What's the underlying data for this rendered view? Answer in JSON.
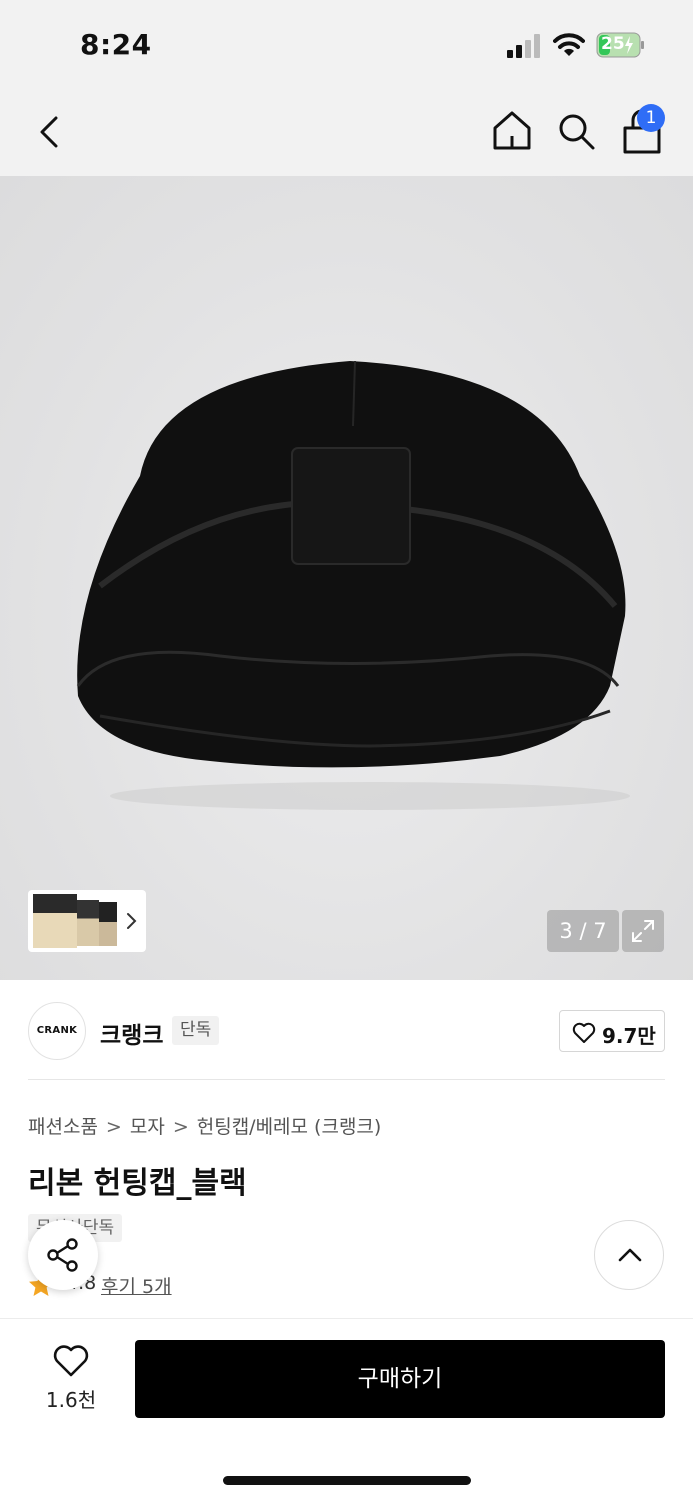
{
  "status_bar": {
    "time": "8:24",
    "battery_level": "25",
    "icons": [
      "signal-icon",
      "wifi-icon",
      "battery-charging-icon"
    ]
  },
  "nav": {
    "icons": [
      "back-arrow-icon",
      "home-icon",
      "search-icon",
      "shopping-bag-icon"
    ],
    "cart_badge": "1"
  },
  "gallery": {
    "counter": "3 / 7",
    "icons": [
      "chevron-right-icon",
      "expand-icon"
    ]
  },
  "brand": {
    "logo_text": "CRANK",
    "name": "크랭크",
    "tag": "단독",
    "like_count": "9.7만"
  },
  "product": {
    "breadcrumb": [
      "패션소품",
      "모자",
      "헌팅캡/베레모 (크랭크)"
    ],
    "breadcrumb_sep": ">",
    "title": "리본 헌팅캡_블랙",
    "tag": "무신사단독",
    "rating": "4.8",
    "review_link": "후기 5개"
  },
  "bottom": {
    "wish_count": "1.6천",
    "buy_label": "구매하기"
  },
  "colors": {
    "accent_blue": "#2f6df6",
    "star": "#f5a623",
    "buy_button": "#000000"
  }
}
